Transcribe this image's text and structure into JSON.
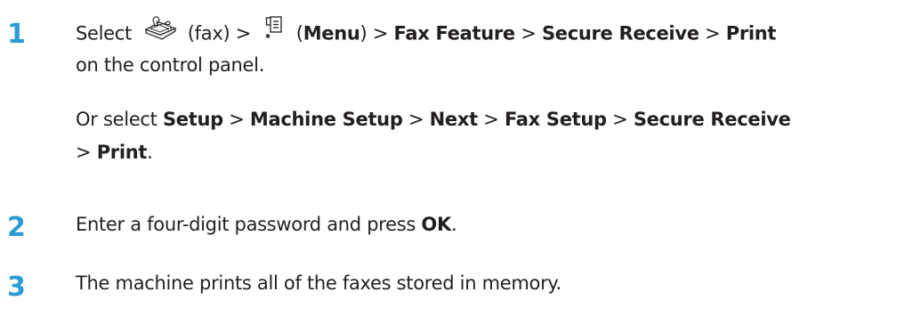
{
  "steps": [
    {
      "number": "1",
      "line1": {
        "select": "Select",
        "fax_label": "(fax) >",
        "menu_open": "(",
        "menu": "Menu",
        "menu_close": ") >",
        "fax_feature": "Fax Feature",
        "sep1": ">",
        "secure_receive": "Secure Receive",
        "sep2": ">",
        "print": "Print"
      },
      "line2": "on the control panel.",
      "alt": {
        "or_select": "Or select",
        "setup": "Setup",
        "sep1": ">",
        "machine_setup": "Machine Setup",
        "sep2": ">",
        "next": "Next",
        "sep3": ">",
        "fax_setup": "Fax Setup",
        "sep4": ">",
        "secure_receive": "Secure Receive",
        "sep5": ">",
        "print": "Print",
        "period": "."
      },
      "icons": [
        "fax-icon",
        "menu-icon"
      ]
    },
    {
      "number": "2",
      "text": "Enter a four-digit password and press",
      "ok": "OK",
      "period": "."
    },
    {
      "number": "3",
      "text": "The machine prints all of the faxes stored in memory."
    }
  ],
  "colors": {
    "step_number": "#2b9bd3",
    "text": "#231f20"
  }
}
